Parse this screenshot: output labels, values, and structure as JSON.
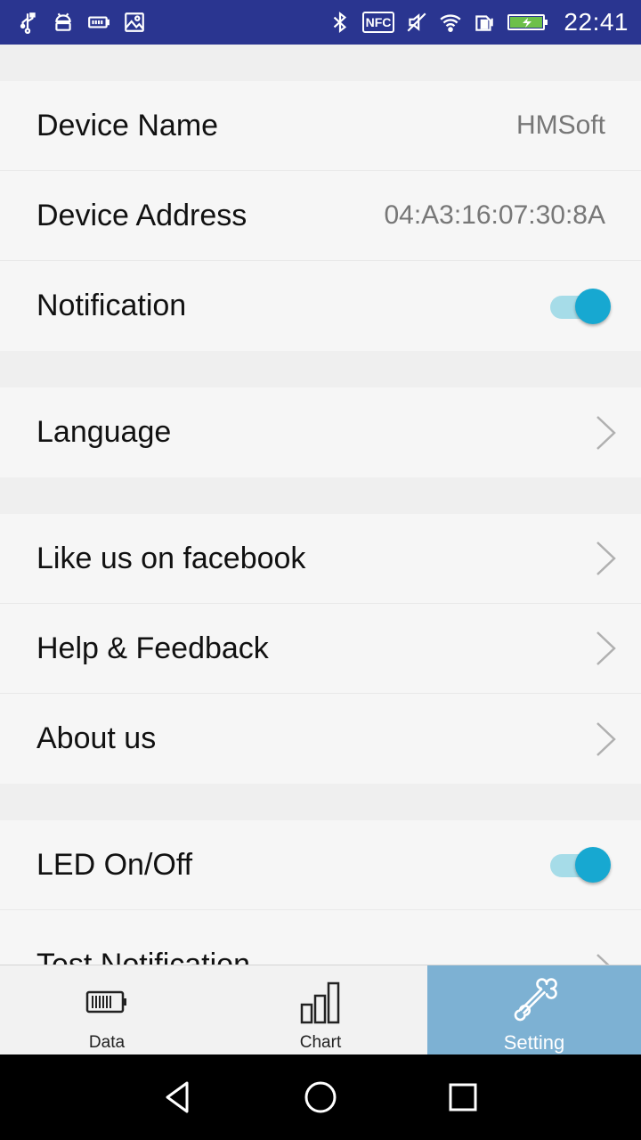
{
  "status_bar": {
    "time": "22:41",
    "nfc_label": "NFC",
    "icons": [
      "usb-icon",
      "android-debug-icon",
      "battery-saver-icon",
      "image-icon",
      "bluetooth-icon",
      "nfc-icon",
      "mute-icon",
      "wifi-icon",
      "sim-icon",
      "battery-charging-icon"
    ]
  },
  "settings": {
    "device_name_label": "Device Name",
    "device_name_value": "HMSoft",
    "device_address_label": "Device Address",
    "device_address_value": "04:A3:16:07:30:8A",
    "notification_label": "Notification",
    "notification_on": true,
    "language_label": "Language",
    "facebook_label": "Like us on facebook",
    "help_label": "Help & Feedback",
    "about_label": "About us",
    "led_label": "LED On/Off",
    "led_on": true,
    "test_notification_label": "Test Notification"
  },
  "tabs": [
    {
      "label": "Data",
      "icon": "battery-icon",
      "active": false
    },
    {
      "label": "Chart",
      "icon": "bar-chart-icon",
      "active": false
    },
    {
      "label": "Setting",
      "icon": "bone-icon",
      "active": true
    }
  ],
  "nav": [
    "back-icon",
    "home-icon",
    "recents-icon"
  ],
  "colors": {
    "status_bar": "#2a3590",
    "accent": "#17a8d1",
    "toggle_track": "#a6dce8",
    "active_tab": "#7db1d3"
  }
}
